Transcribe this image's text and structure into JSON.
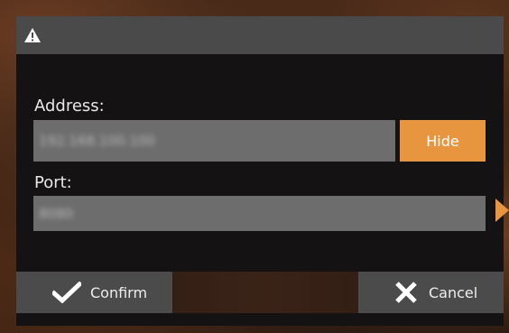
{
  "dialog": {
    "title_icon": "warning-icon",
    "address": {
      "label": "Address:",
      "value": "192.168.100.100",
      "hide_label": "Hide"
    },
    "port": {
      "label": "Port:",
      "value": "8080"
    },
    "buttons": {
      "confirm_label": "Confirm",
      "cancel_label": "Cancel"
    }
  },
  "colors": {
    "accent": "#e8953f",
    "field_bg": "#6d6d6d",
    "titlebar_bg": "#4a4a4a",
    "dialog_bg": "#141212",
    "button_bg": "#4b4b4b"
  }
}
